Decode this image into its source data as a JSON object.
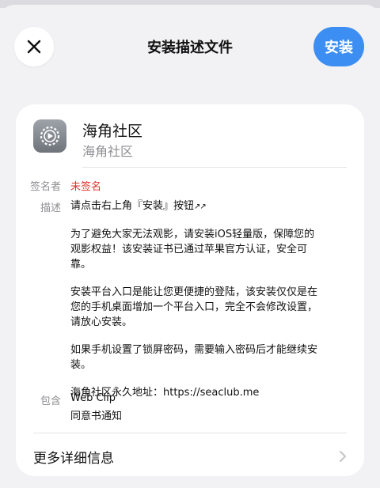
{
  "header": {
    "title": "安装描述文件",
    "install_label": "安装"
  },
  "profile": {
    "name": "海角社区",
    "subtitle": "海角社区"
  },
  "signer": {
    "label": "签名者",
    "value": "未签名"
  },
  "description": {
    "label": "描述",
    "line1": "请点击右上角『安装』按钮",
    "line1_icon": "↗↗",
    "para1": "为了避免大家无法观影，请安装iOS轻量版，保障您的观影权益！该安装证书已通过苹果官方认证，安全可靠。",
    "para2": "安装平台入口是能让您更便捷的登陆，该安装仅仅是在您的手机桌面增加一个平台入口，完全不会修改设置，请放心安装。",
    "para3": "如果手机设置了锁屏密码，需要输入密码后才能继续安装。",
    "para4": "海角社区永久地址：https://seaclub.me"
  },
  "contains": {
    "label": "包含",
    "items": [
      "Web Clip",
      "同意书通知"
    ]
  },
  "more": {
    "label": "更多详细信息"
  },
  "colors": {
    "accent": "#3d8ef3",
    "unsigned": "#e0352b",
    "secondary_text": "#8e8e93"
  },
  "icons": {
    "close": "close-icon",
    "app": "settings-gear-icon",
    "chevron": "chevron-right-icon"
  }
}
